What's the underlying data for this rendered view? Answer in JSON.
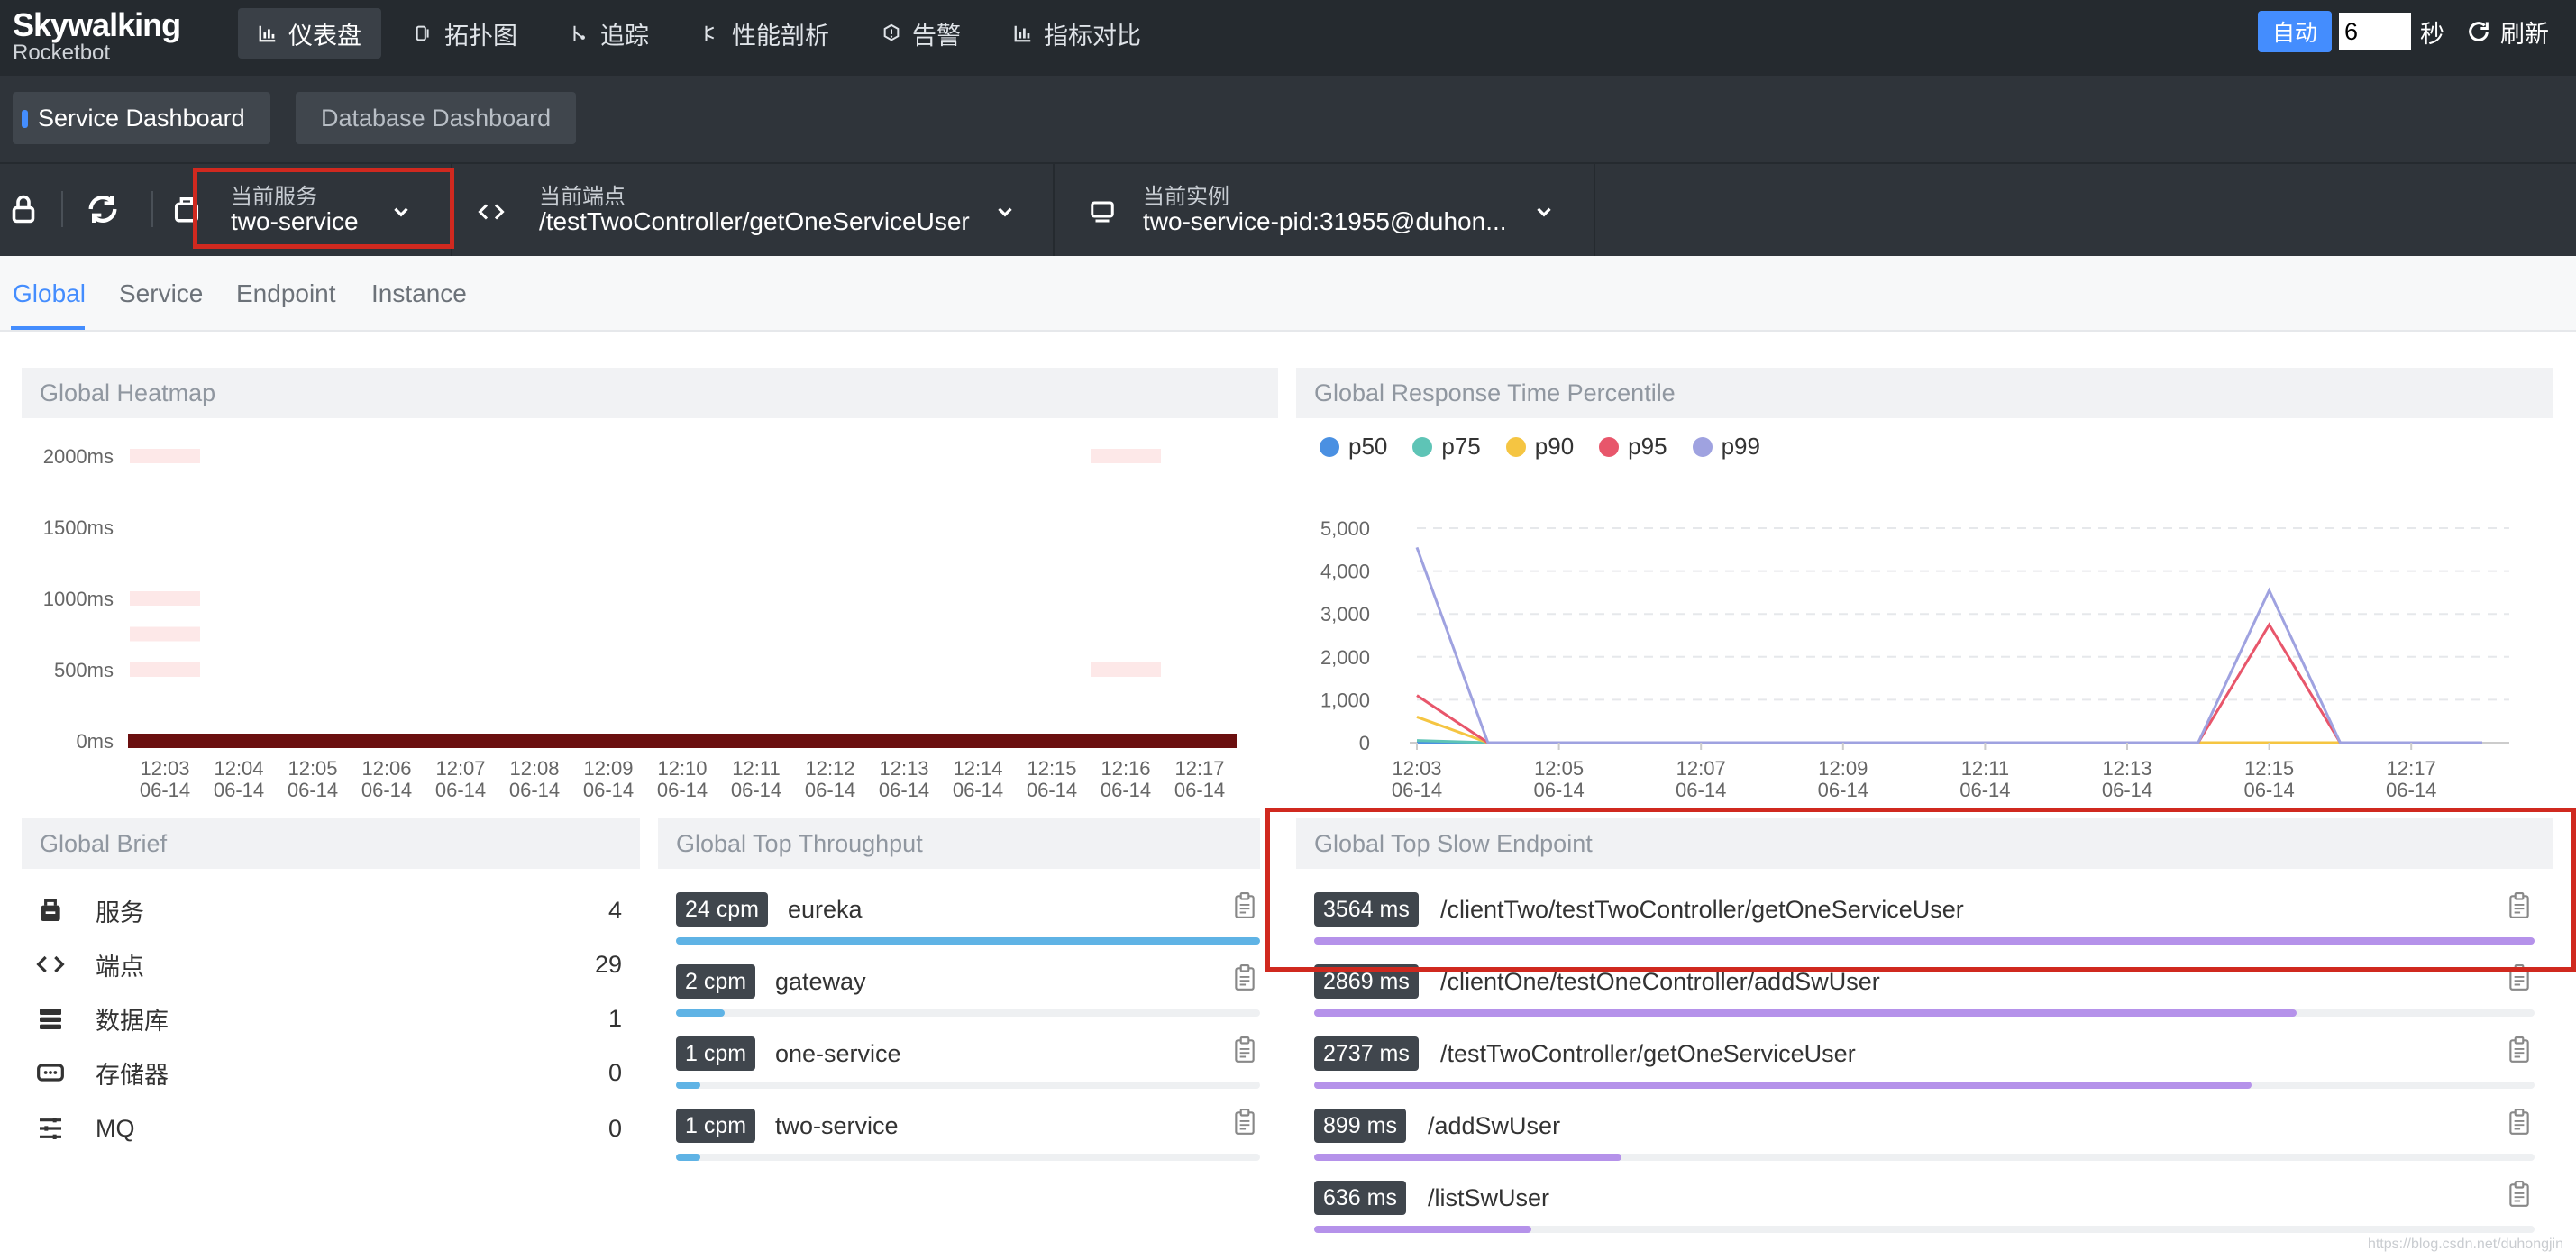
{
  "logo": {
    "name": "Skywalking",
    "sub": "Rocketbot"
  },
  "nav": [
    {
      "label": "仪表盘",
      "icon": "bar-chart-icon",
      "active": true
    },
    {
      "label": "拓扑图",
      "icon": "topology-icon",
      "active": false
    },
    {
      "label": "追踪",
      "icon": "trace-icon",
      "active": false
    },
    {
      "label": "性能剖析",
      "icon": "profile-icon",
      "active": false
    },
    {
      "label": "告警",
      "icon": "alarm-icon",
      "active": false
    },
    {
      "label": "指标对比",
      "icon": "compare-chart-icon",
      "active": false
    }
  ],
  "top_right": {
    "auto_label": "自动",
    "interval_value": "6",
    "sec_label": "秒",
    "refresh_label": "刷新"
  },
  "dashboards": {
    "active": "Service Dashboard",
    "inactive": "Database Dashboard"
  },
  "selectors": {
    "service": {
      "label": "当前服务",
      "value": "two-service"
    },
    "endpoint": {
      "label": "当前端点",
      "value": "/testTwoController/getOneServiceUser"
    },
    "instance": {
      "label": "当前实例",
      "value": "two-service-pid:31955@duhon..."
    }
  },
  "subtabs": [
    "Global",
    "Service",
    "Endpoint",
    "Instance"
  ],
  "panels": {
    "heatmap": "Global Heatmap",
    "percentile": "Global Response Time Percentile",
    "brief": "Global Brief",
    "throughput": "Global Top Throughput",
    "slow": "Global Top Slow Endpoint"
  },
  "heatmap": {
    "y_ticks": [
      "2000ms",
      "1500ms",
      "1000ms",
      "500ms",
      "0ms"
    ],
    "x_ticks": [
      "12:03",
      "12:04",
      "12:05",
      "12:06",
      "12:07",
      "12:08",
      "12:09",
      "12:10",
      "12:11",
      "12:12",
      "12:13",
      "12:14",
      "12:15",
      "12:16",
      "12:17"
    ],
    "x_date": "06-14",
    "base_color": "#6b0f0f",
    "light_color": "#fde8e8",
    "light_cells": [
      {
        "col": 0,
        "ms": 2000
      },
      {
        "col": 0,
        "ms": 1000
      },
      {
        "col": 0,
        "ms": 750
      },
      {
        "col": 0,
        "ms": 500
      },
      {
        "col": 13,
        "ms": 2000
      },
      {
        "col": 13,
        "ms": 500
      }
    ]
  },
  "chart_data": {
    "type": "line",
    "x": [
      "12:03",
      "12:04",
      "12:05",
      "12:06",
      "12:07",
      "12:08",
      "12:09",
      "12:10",
      "12:11",
      "12:12",
      "12:13",
      "12:14",
      "12:15",
      "12:16",
      "12:17",
      "12:18"
    ],
    "x_tick_labels": [
      "12:03",
      "12:05",
      "12:07",
      "12:09",
      "12:11",
      "12:13",
      "12:15",
      "12:17"
    ],
    "x_date": "06-14",
    "y_ticks": [
      "5,000",
      "4,000",
      "3,000",
      "2,000",
      "1,000",
      "0"
    ],
    "ylim": [
      0,
      5000
    ],
    "legend": "top-left",
    "series": [
      {
        "name": "p50",
        "color": "#4a90e2",
        "values": [
          0,
          0,
          0,
          0,
          0,
          0,
          0,
          0,
          0,
          0,
          0,
          0,
          0,
          0,
          0,
          0
        ]
      },
      {
        "name": "p75",
        "color": "#5ec4b6",
        "values": [
          50,
          0,
          0,
          0,
          0,
          0,
          0,
          0,
          0,
          0,
          0,
          0,
          0,
          0,
          0,
          0
        ]
      },
      {
        "name": "p90",
        "color": "#f5c542",
        "values": [
          600,
          0,
          0,
          0,
          0,
          0,
          0,
          0,
          0,
          0,
          0,
          0,
          0,
          0,
          0,
          0
        ]
      },
      {
        "name": "p95",
        "color": "#e8566b",
        "values": [
          1100,
          0,
          0,
          0,
          0,
          0,
          0,
          0,
          0,
          0,
          0,
          0,
          2750,
          0,
          0,
          0
        ]
      },
      {
        "name": "p99",
        "color": "#9fa2e0",
        "values": [
          4550,
          0,
          0,
          0,
          0,
          0,
          0,
          0,
          0,
          0,
          0,
          0,
          3550,
          0,
          0,
          0
        ]
      }
    ]
  },
  "brief": [
    {
      "label": "服务",
      "value": "4",
      "icon": "package-icon"
    },
    {
      "label": "端点",
      "value": "29",
      "icon": "code-icon"
    },
    {
      "label": "数据库",
      "value": "1",
      "icon": "database-icon"
    },
    {
      "label": "存储器",
      "value": "0",
      "icon": "storage-icon"
    },
    {
      "label": "MQ",
      "value": "0",
      "icon": "mq-icon"
    }
  ],
  "throughput": [
    {
      "badge": "24 cpm",
      "name": "eureka",
      "fraction": 1.0
    },
    {
      "badge": "2 cpm",
      "name": "gateway",
      "fraction": 0.083
    },
    {
      "badge": "1 cpm",
      "name": "one-service",
      "fraction": 0.042
    },
    {
      "badge": "1 cpm",
      "name": "two-service",
      "fraction": 0.042
    }
  ],
  "throughput_color": "#5fb3e5",
  "slow": [
    {
      "badge": "3564 ms",
      "name": "/clientTwo/testTwoController/getOneServiceUser",
      "fraction": 1.0
    },
    {
      "badge": "2869 ms",
      "name": "/clientOne/testOneController/addSwUser",
      "fraction": 0.805
    },
    {
      "badge": "2737 ms",
      "name": "/testTwoController/getOneServiceUser",
      "fraction": 0.768
    },
    {
      "badge": "899 ms",
      "name": "/addSwUser",
      "fraction": 0.252
    },
    {
      "badge": "636 ms",
      "name": "/listSwUser",
      "fraction": 0.178
    }
  ],
  "slow_color": "#b592ea",
  "watermark": "https://blog.csdn.net/duhongjin"
}
